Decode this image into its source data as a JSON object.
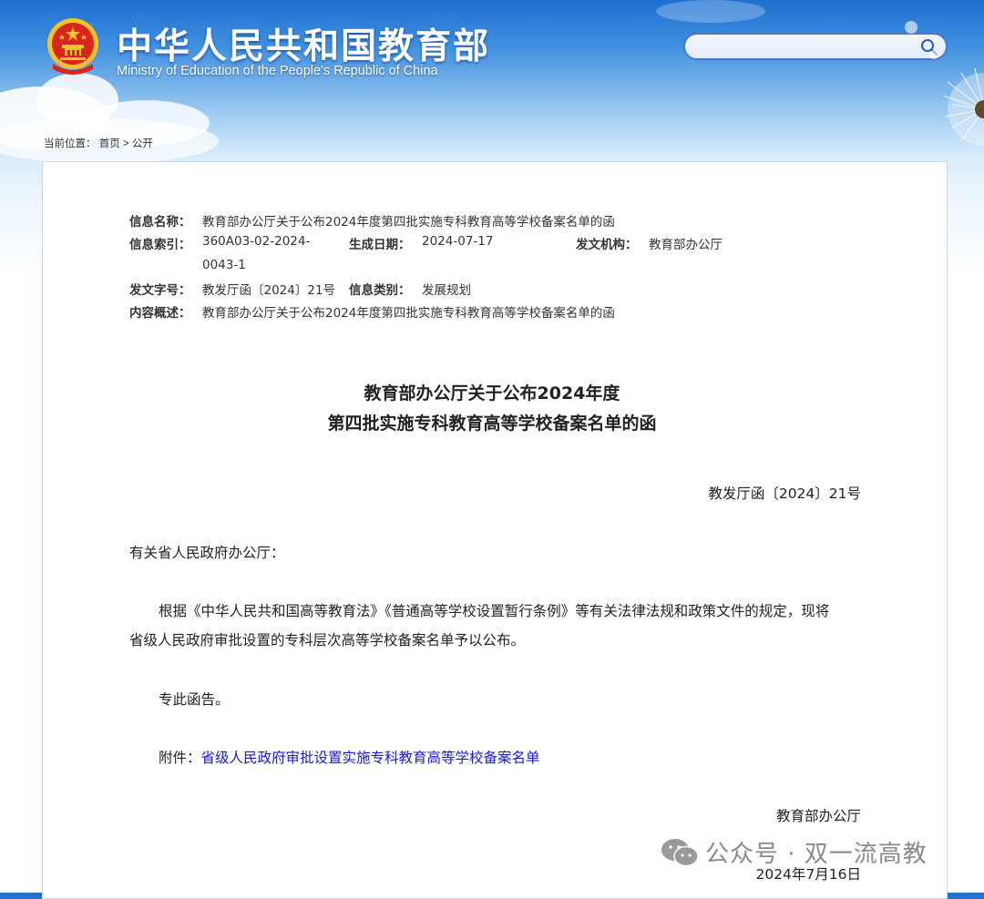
{
  "header": {
    "site_title": "中华人民共和国教育部",
    "site_subtitle": "Ministry of Education of the People's Republic of China",
    "search_placeholder": ""
  },
  "breadcrumb": {
    "prefix": "当前位置：",
    "home": "首页",
    "separator": ">",
    "current": "公开"
  },
  "meta": {
    "name_label": "信息名称：",
    "name_value": "教育部办公厅关于公布2024年度第四批实施专科教育高等学校备案名单的函",
    "index_label": "信息索引：",
    "index_value_line1": "360A03-02-2024-",
    "index_value_line2": "0043-1",
    "date_label": "生成日期：",
    "date_value": "2024-07-17",
    "issuer_label": "发文机构：",
    "issuer_value": "教育部办公厅",
    "docnum_label": "发文字号：",
    "docnum_value": "教发厅函〔2024〕21号",
    "category_label": "信息类别：",
    "category_value": "发展规划",
    "summary_label": "内容概述：",
    "summary_value": "教育部办公厅关于公布2024年度第四批实施专科教育高等学校备案名单的函"
  },
  "document": {
    "title_line1": "教育部办公厅关于公布2024年度",
    "title_line2": "第四批实施专科教育高等学校备案名单的函",
    "doc_number": "教发厅函〔2024〕21号",
    "salutation": "有关省人民政府办公厅：",
    "para1_line1": "根据《中华人民共和国高等教育法》《普通高等学校设置暂行条例》等有关法律法规和政策文件的规定，现将",
    "para1_line2": "省级人民政府审批设置的专科层次高等学校备案名单予以公布。",
    "para2": "专此函告。",
    "attachment_label": "附件：",
    "attachment_link": "省级人民政府审批设置实施专科教育高等学校备案名单",
    "signature": "教育部办公厅",
    "date": "2024年7月16日"
  },
  "watermark": {
    "text": "公众号 · 双一流高教"
  },
  "colors": {
    "header_blue": "#1f6fd0",
    "link_blue": "#1a1adb",
    "emblem_red": "#d8261c",
    "emblem_gold": "#f2c230"
  }
}
